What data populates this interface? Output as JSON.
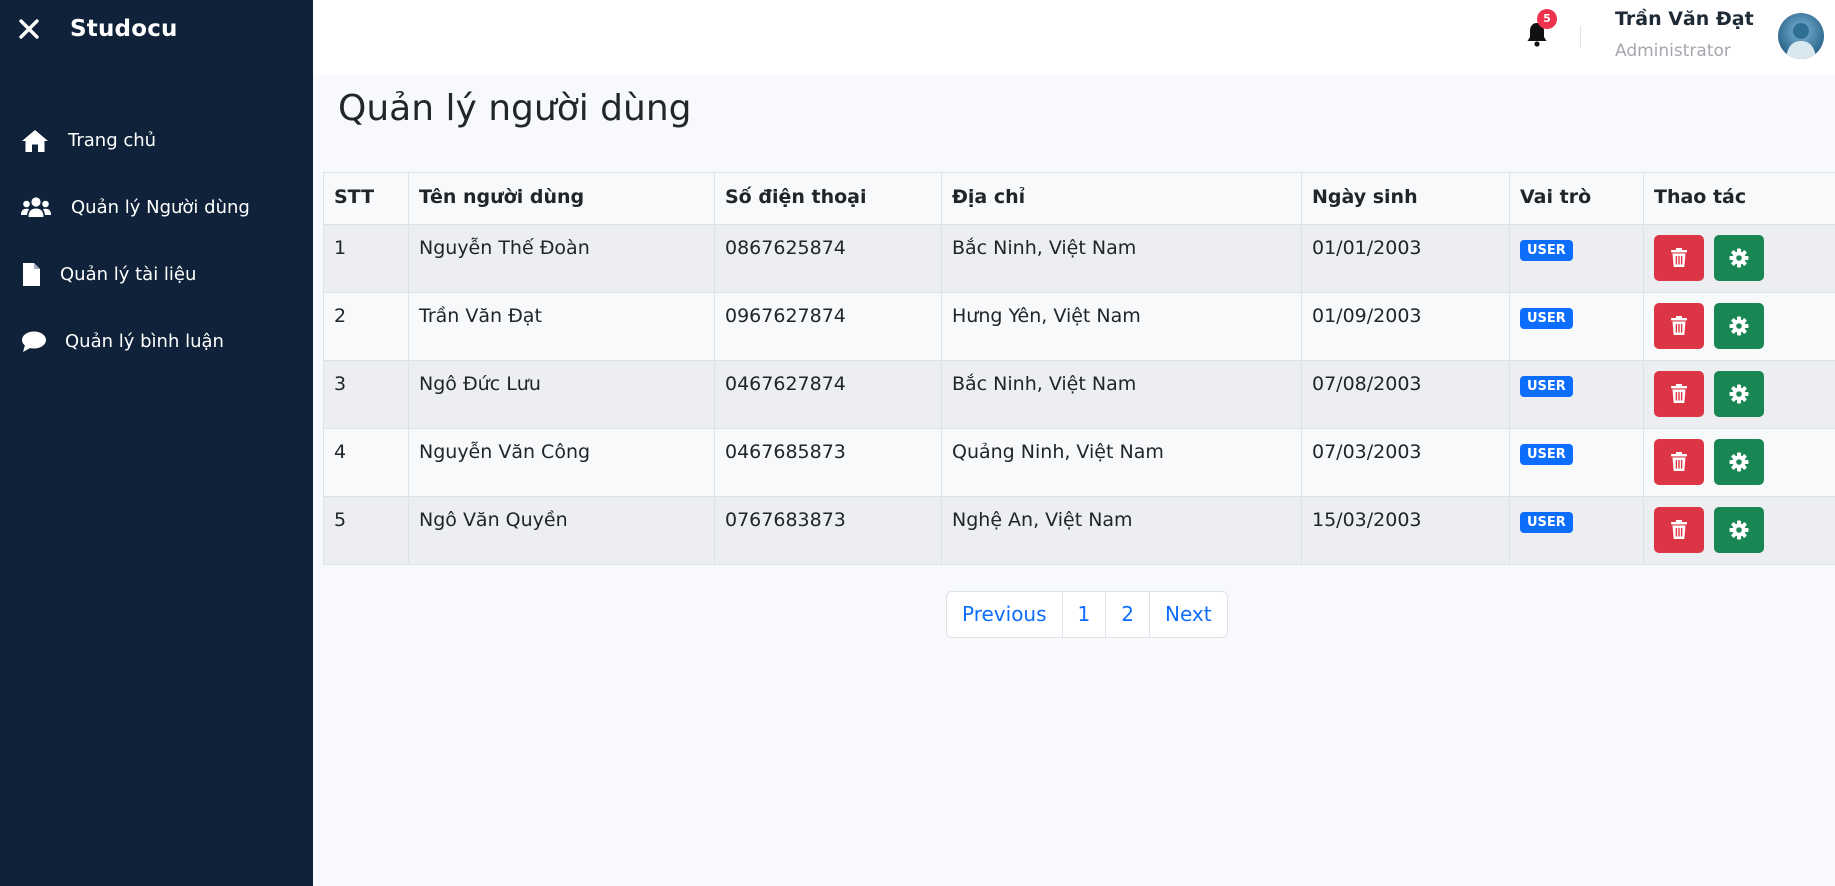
{
  "sidebar": {
    "brand": "Studocu",
    "close_icon": "close-icon",
    "items": [
      {
        "label": "Trang chủ",
        "icon": "home-icon"
      },
      {
        "label": "Quản lý Người dùng",
        "icon": "users-icon"
      },
      {
        "label": "Quản lý tài liệu",
        "icon": "file-icon"
      },
      {
        "label": "Quản lý bình luận",
        "icon": "comment-icon"
      }
    ]
  },
  "header": {
    "notification_count": "5",
    "user_name": "Trần Văn Đạt",
    "user_role": "Administrator"
  },
  "main": {
    "title": "Quản lý người dùng",
    "table": {
      "headers": [
        "STT",
        "Tên người dùng",
        "Số điện thoại",
        "Địa chỉ",
        "Ngày sinh",
        "Vai trò",
        "Thao tác"
      ],
      "rows": [
        {
          "stt": "1",
          "name": "Nguyễn Thế Đoàn",
          "phone": "0867625874",
          "address": "Bắc Ninh, Việt Nam",
          "dob": "01/01/2003",
          "role": "USER"
        },
        {
          "stt": "2",
          "name": "Trần Văn Đạt",
          "phone": "0967627874",
          "address": "Hưng Yên, Việt Nam",
          "dob": "01/09/2003",
          "role": "USER"
        },
        {
          "stt": "3",
          "name": "Ngô Đức Lưu",
          "phone": "0467627874",
          "address": "Bắc Ninh, Việt Nam",
          "dob": "07/08/2003",
          "role": "USER"
        },
        {
          "stt": "4",
          "name": "Nguyễn Văn Công",
          "phone": "0467685873",
          "address": "Quảng Ninh, Việt Nam",
          "dob": "07/03/2003",
          "role": "USER"
        },
        {
          "stt": "5",
          "name": "Ngô Văn Quyền",
          "phone": "0767683873",
          "address": "Nghệ An, Việt Nam",
          "dob": "15/03/2003",
          "role": "USER"
        }
      ]
    },
    "pagination": {
      "previous": "Previous",
      "pages": [
        "1",
        "2"
      ],
      "next": "Next"
    }
  },
  "colors": {
    "sidebar_bg": "#0f2239",
    "badge_user": "#0d6efd",
    "delete_button": "#dc3545",
    "settings_button": "#198754",
    "notification_badge": "#f0334d"
  }
}
